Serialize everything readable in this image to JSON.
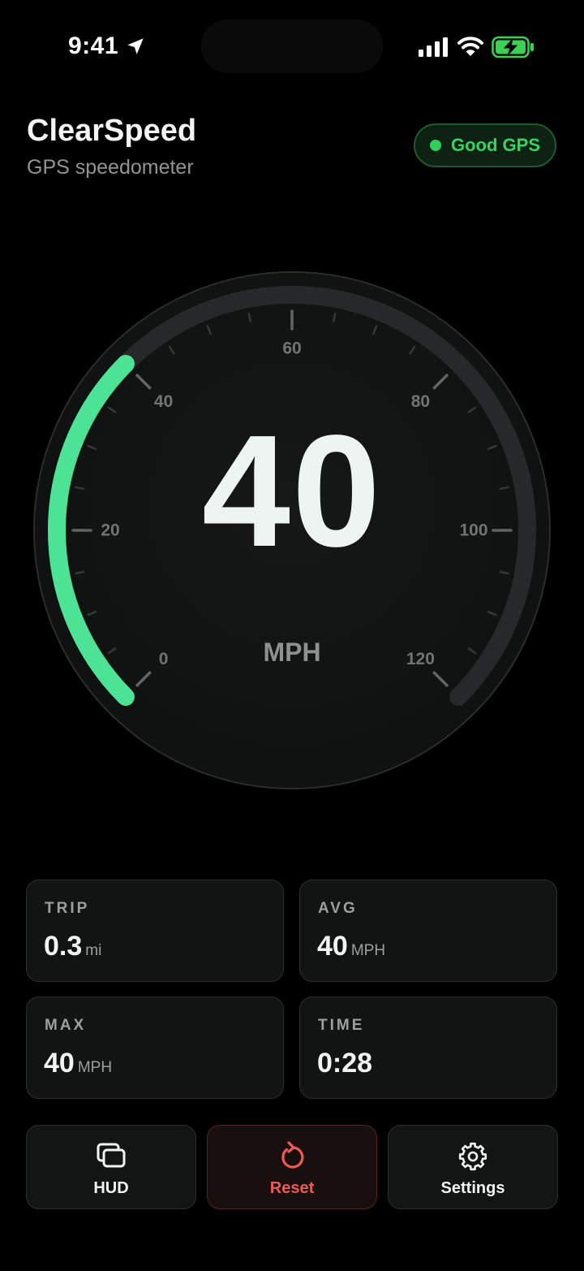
{
  "status_bar": {
    "time": "9:41"
  },
  "header": {
    "title": "ClearSpeed",
    "subtitle": "GPS speedometer",
    "gps_status": "Good GPS"
  },
  "gauge": {
    "speed": "40",
    "unit": "MPH",
    "value": 40,
    "min": 0,
    "max": 120,
    "tick_labels": [
      "0",
      "20",
      "40",
      "60",
      "80",
      "100",
      "120"
    ],
    "accent_color": "#4de394"
  },
  "stats": {
    "trip": {
      "label": "TRIP",
      "value": "0.3",
      "unit": "mi"
    },
    "avg": {
      "label": "AVG",
      "value": "40",
      "unit": "MPH"
    },
    "max": {
      "label": "MAX",
      "value": "40",
      "unit": "MPH"
    },
    "time": {
      "label": "TIME",
      "value": "0:28"
    }
  },
  "actions": {
    "hud": "HUD",
    "reset": "Reset",
    "settings": "Settings"
  },
  "colors": {
    "background": "#000000",
    "gps_green": "#35d35f",
    "reset_red": "#ef5b54"
  },
  "icons": {
    "status": [
      "location-arrow-icon",
      "cellular-signal-icon",
      "wifi-icon",
      "battery-charging-icon"
    ],
    "actions": [
      "hud-windows-icon",
      "reset-rotate-icon",
      "gear-icon"
    ]
  }
}
